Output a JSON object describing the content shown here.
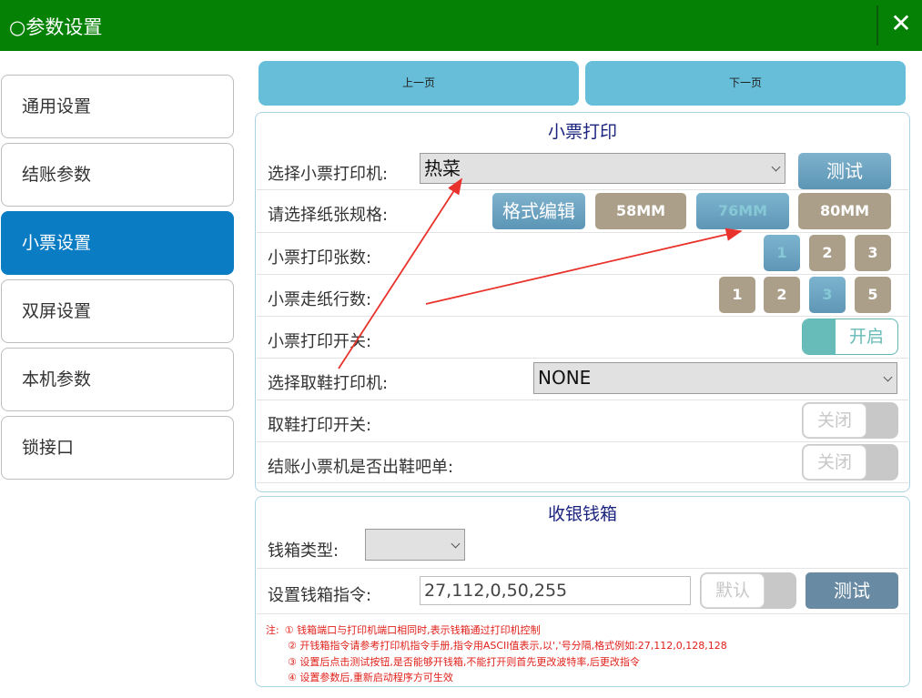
{
  "window": {
    "title": "○参数设置",
    "close_icon": "close-icon"
  },
  "sidebar": {
    "items": [
      {
        "label": "通用设置",
        "active": false
      },
      {
        "label": "结账参数",
        "active": false
      },
      {
        "label": "小票设置",
        "active": true
      },
      {
        "label": "双屏设置",
        "active": false
      },
      {
        "label": "本机参数",
        "active": false
      },
      {
        "label": "锁接口",
        "active": false
      }
    ],
    "active_color": "#0a7cc4"
  },
  "pager": {
    "prev_label": "上一页",
    "next_label": "下一页"
  },
  "receipt": {
    "title": "小票打印",
    "printer_label": "选择小票打印机:",
    "printer_value": "热菜",
    "test_label": "测试",
    "paper_label": "请选择纸张规格:",
    "format_edit_label": "格式编辑",
    "paper_sizes": [
      "58MM",
      "76MM",
      "80MM"
    ],
    "paper_selected": "76MM",
    "copies_label": "小票打印张数:",
    "copies_options": [
      "1",
      "2",
      "3"
    ],
    "copies_selected": "1",
    "feed_label": "小票走纸行数:",
    "feed_options": [
      "1",
      "2",
      "3",
      "5"
    ],
    "feed_selected": "3",
    "print_switch_label": "小票打印开关:",
    "print_switch_text": "开启",
    "shoe_printer_label": "选择取鞋打印机:",
    "shoe_printer_value": "NONE",
    "shoe_switch_label": "取鞋打印开关:",
    "shoe_switch_text": "关闭",
    "bar_label": "结账小票机是否出鞋吧单:",
    "bar_switch_text": "关闭"
  },
  "cashbox": {
    "title": "收银钱箱",
    "type_label": "钱箱类型:",
    "type_value": "",
    "command_label": "设置钱箱指令:",
    "command_value": "27,112,0,50,255",
    "default_label": "默认",
    "test_label": "测试"
  },
  "notes": {
    "prefix": "注:",
    "lines": [
      "① 钱箱端口与打印机端口相同时,表示钱箱通过打印机控制",
      "② 开钱箱指令请参考打印机指令手册,指令用ASCII值表示,以','号分隔,格式例如:27,112,0,128,128",
      "③ 设置后点击测试按钮,是否能够开钱箱,不能打开则首先更改波特率,后更改指令",
      "④ 设置参数后,重新启动程序方可生效"
    ]
  },
  "colors": {
    "title_bar": "#058205",
    "annotation_arrow": "#e8322b",
    "note_text": "#e0201a"
  }
}
